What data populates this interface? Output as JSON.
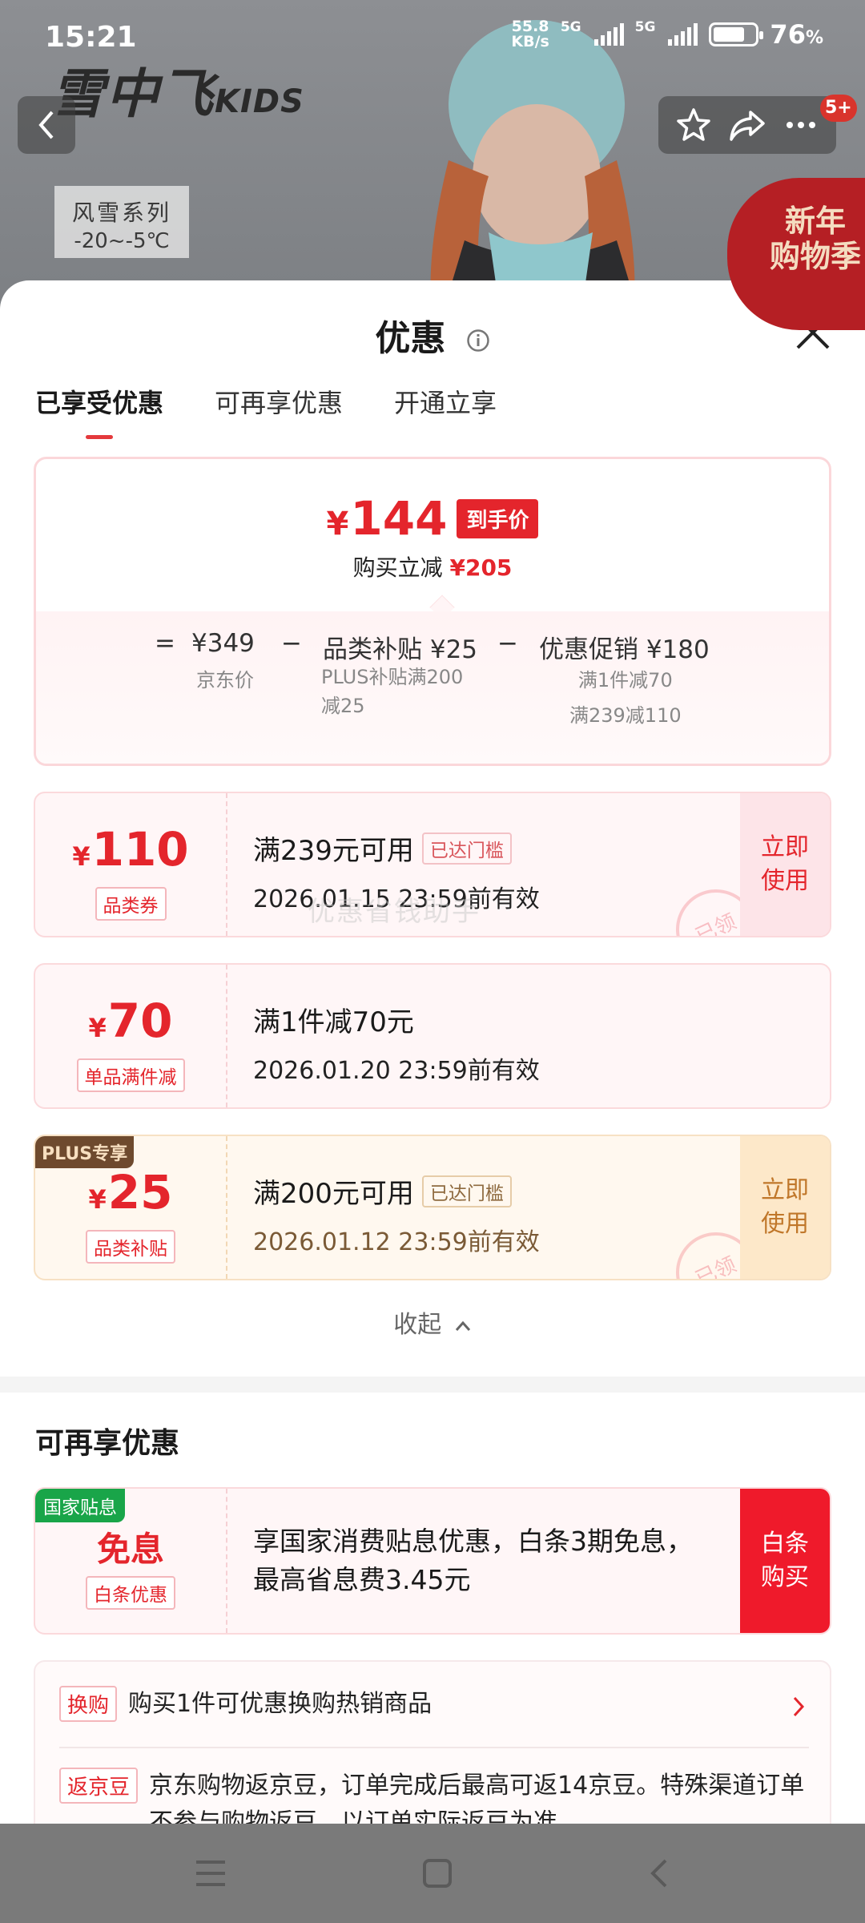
{
  "status_bar": {
    "time": "15:21",
    "net_speed_top": "55.8",
    "net_speed_unit": "KB/s",
    "sim1": "5G",
    "sim2": "5G",
    "battery": "76",
    "battery_unit": "%",
    "battery_level": 0.76
  },
  "background": {
    "brand": "雪中飞",
    "brand_suffix": "KIDS",
    "series_line1": "风雪系列",
    "series_line2": "-20~-5℃",
    "promo_line1": "新年",
    "promo_line2": "购物季",
    "cart_badge": "5+"
  },
  "sheet": {
    "title": "优惠",
    "tabs": [
      "已享受优惠",
      "可再享优惠",
      "开通立享"
    ],
    "active_tab": 0
  },
  "summary": {
    "currency": "¥",
    "final_price": "144",
    "final_tag": "到手价",
    "reduce_label": "购买立减",
    "reduce_amount": "¥205",
    "eq": "=",
    "minus": "−",
    "base_price": "¥349",
    "base_label": "京东价",
    "subsidy": "品类补贴 ¥25",
    "subsidy_note_1": "PLUS补贴满200",
    "subsidy_note_2": "减25",
    "promo": "优惠促销 ¥180",
    "promo_note_1": "满1件减70",
    "promo_note_2": "满239减110"
  },
  "coupons": [
    {
      "amount": "110",
      "type": "品类券",
      "condition": "满239元可用",
      "tag": "已达门槛",
      "expiry": "2026.01.15 23:59前有效",
      "action": [
        "立即",
        "使用"
      ],
      "stamp": "已领",
      "watermark": "优惠省钱助手"
    },
    {
      "amount": "70",
      "type": "单品满件减",
      "condition": "满1件减70元",
      "expiry": "2026.01.20 23:59前有效"
    },
    {
      "plus_badge": "PLUS专享",
      "amount": "25",
      "type": "品类补贴",
      "condition": "满200元可用",
      "tag": "已达门槛",
      "expiry": "2026.01.12 23:59前有效",
      "action": [
        "立即",
        "使用"
      ],
      "stamp": "已领"
    }
  ],
  "collapse_label": "收起",
  "more": {
    "section_title": "可再享优惠",
    "gov_badge": "国家贴息",
    "gov_main": "免息",
    "gov_type": "白条优惠",
    "gov_text": "享国家消费贴息优惠，白条3期免息，最高省息费3.45元",
    "gov_action": [
      "白条",
      "购买"
    ],
    "exchange_tag": "换购",
    "exchange_text": "购买1件可优惠换购热销商品",
    "bean_tag": "返京豆",
    "bean_text": "京东购物返京豆，订单完成后最高可返14京豆。特殊渠道订单不参与购物返豆，以订单实际返豆为准"
  },
  "colors": {
    "accent": "#e4252c",
    "plus_brown": "#6e4a2e",
    "gov_green": "#19a549"
  }
}
